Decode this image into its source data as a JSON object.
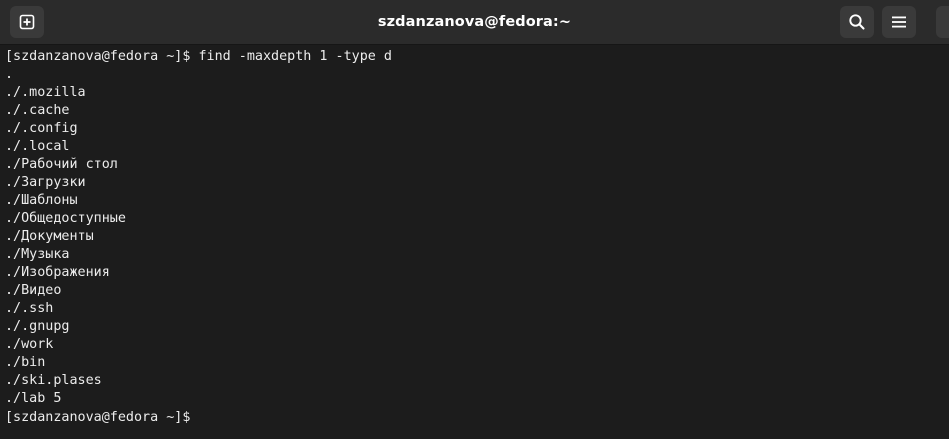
{
  "window": {
    "title": "szdanzanova@fedora:~"
  },
  "header": {
    "new_tab_icon": "new-tab-plus-icon",
    "search_icon": "search-icon",
    "menu_icon": "hamburger-menu-icon"
  },
  "terminal": {
    "command_line": {
      "prompt": "[szdanzanova@fedora ~]$ ",
      "command": "find -maxdepth 1 -type d"
    },
    "output": [
      ".",
      "./.mozilla",
      "./.cache",
      "./.config",
      "./.local",
      "./Рабочий стол",
      "./Загрузки",
      "./Шаблоны",
      "./Общедоступные",
      "./Документы",
      "./Музыка",
      "./Изображения",
      "./Видео",
      "./.ssh",
      "./.gnupg",
      "./work",
      "./bin",
      "./ski.plases",
      "./lab 5"
    ],
    "final_prompt": "[szdanzanova@fedora ~]$"
  },
  "colors": {
    "background": "#1c1c1c",
    "headerbar": "#2b2b2b",
    "button": "#3a3a3a",
    "text": "#ececec"
  }
}
